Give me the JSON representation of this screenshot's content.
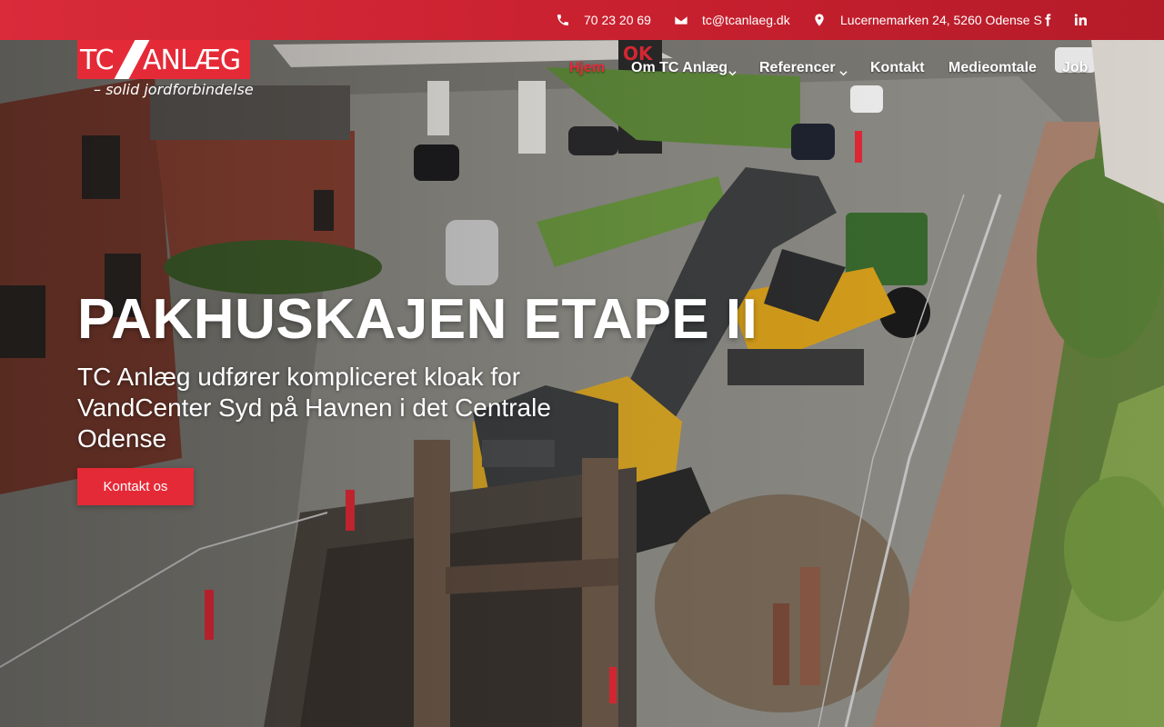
{
  "topbar": {
    "phone": "70 23 20 69",
    "email": "tc@tcanlaeg.dk",
    "address": "Lucernemarken 24, 5260 Odense S",
    "icons": {
      "phone": "phone-icon",
      "email": "envelope-icon",
      "address": "map-pin-icon",
      "facebook": "facebook-icon",
      "linkedin": "linkedin-icon"
    }
  },
  "logo": {
    "tc": "TC",
    "anlaeg": "ANLÆG",
    "tagline": "– solid jordforbindelse"
  },
  "nav": {
    "items": [
      {
        "label": "Hjem",
        "active": true
      },
      {
        "label": "Om TC Anlæg",
        "has_dropdown": true
      },
      {
        "label": "Referencer",
        "has_dropdown": true
      },
      {
        "label": "Kontakt"
      },
      {
        "label": "Medieomtale"
      },
      {
        "label": "Job"
      }
    ]
  },
  "hero": {
    "title": "PAKHUSKAJEN ETAPE II",
    "subtitle": "TC Anlæg udfører kompliceret kloak for VandCenter Syd på Havnen i det Centrale Odense",
    "cta_label": "Kontakt os"
  },
  "colors": {
    "brand_red": "#e52a37",
    "topbar_red": "#c8202f",
    "text": "#ffffff"
  }
}
